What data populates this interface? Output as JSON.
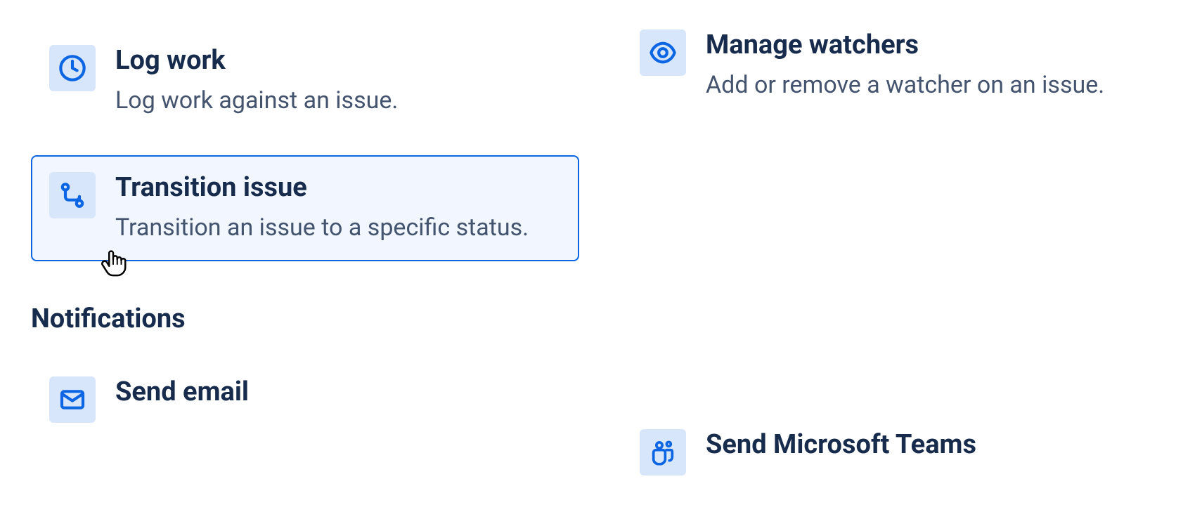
{
  "actions": {
    "log_work": {
      "title": "Log work",
      "desc": "Log work against an issue."
    },
    "transition_issue": {
      "title": "Transition issue",
      "desc": "Transition an issue to a specific status."
    },
    "manage_watchers": {
      "title": "Manage watchers",
      "desc": "Add or remove a watcher on an issue."
    },
    "send_email": {
      "title": "Send email"
    },
    "send_ms_teams": {
      "title": "Send Microsoft Teams"
    }
  },
  "sections": {
    "notifications": "Notifications"
  }
}
